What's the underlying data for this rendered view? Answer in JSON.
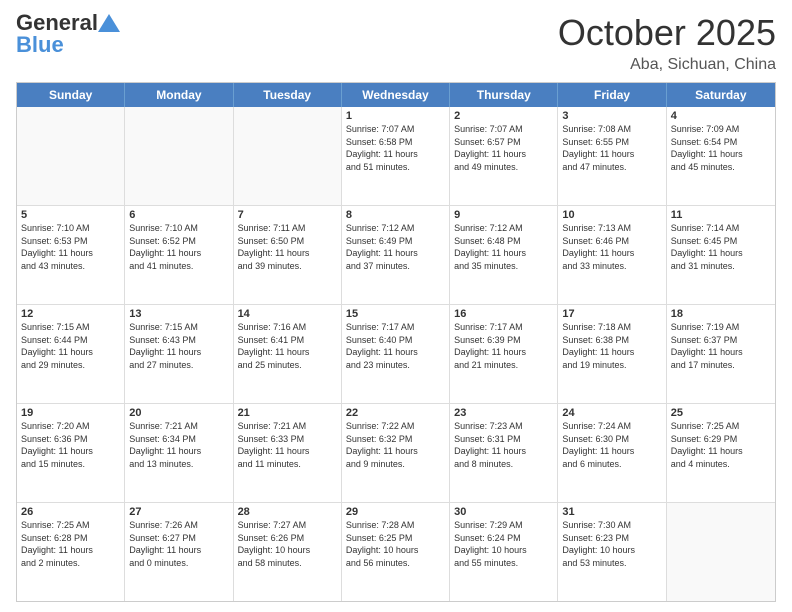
{
  "header": {
    "logo_general": "General",
    "logo_blue": "Blue",
    "title": "October 2025",
    "location": "Aba, Sichuan, China"
  },
  "days_of_week": [
    "Sunday",
    "Monday",
    "Tuesday",
    "Wednesday",
    "Thursday",
    "Friday",
    "Saturday"
  ],
  "weeks": [
    [
      {
        "day": "",
        "info": ""
      },
      {
        "day": "",
        "info": ""
      },
      {
        "day": "",
        "info": ""
      },
      {
        "day": "1",
        "info": "Sunrise: 7:07 AM\nSunset: 6:58 PM\nDaylight: 11 hours\nand 51 minutes."
      },
      {
        "day": "2",
        "info": "Sunrise: 7:07 AM\nSunset: 6:57 PM\nDaylight: 11 hours\nand 49 minutes."
      },
      {
        "day": "3",
        "info": "Sunrise: 7:08 AM\nSunset: 6:55 PM\nDaylight: 11 hours\nand 47 minutes."
      },
      {
        "day": "4",
        "info": "Sunrise: 7:09 AM\nSunset: 6:54 PM\nDaylight: 11 hours\nand 45 minutes."
      }
    ],
    [
      {
        "day": "5",
        "info": "Sunrise: 7:10 AM\nSunset: 6:53 PM\nDaylight: 11 hours\nand 43 minutes."
      },
      {
        "day": "6",
        "info": "Sunrise: 7:10 AM\nSunset: 6:52 PM\nDaylight: 11 hours\nand 41 minutes."
      },
      {
        "day": "7",
        "info": "Sunrise: 7:11 AM\nSunset: 6:50 PM\nDaylight: 11 hours\nand 39 minutes."
      },
      {
        "day": "8",
        "info": "Sunrise: 7:12 AM\nSunset: 6:49 PM\nDaylight: 11 hours\nand 37 minutes."
      },
      {
        "day": "9",
        "info": "Sunrise: 7:12 AM\nSunset: 6:48 PM\nDaylight: 11 hours\nand 35 minutes."
      },
      {
        "day": "10",
        "info": "Sunrise: 7:13 AM\nSunset: 6:46 PM\nDaylight: 11 hours\nand 33 minutes."
      },
      {
        "day": "11",
        "info": "Sunrise: 7:14 AM\nSunset: 6:45 PM\nDaylight: 11 hours\nand 31 minutes."
      }
    ],
    [
      {
        "day": "12",
        "info": "Sunrise: 7:15 AM\nSunset: 6:44 PM\nDaylight: 11 hours\nand 29 minutes."
      },
      {
        "day": "13",
        "info": "Sunrise: 7:15 AM\nSunset: 6:43 PM\nDaylight: 11 hours\nand 27 minutes."
      },
      {
        "day": "14",
        "info": "Sunrise: 7:16 AM\nSunset: 6:41 PM\nDaylight: 11 hours\nand 25 minutes."
      },
      {
        "day": "15",
        "info": "Sunrise: 7:17 AM\nSunset: 6:40 PM\nDaylight: 11 hours\nand 23 minutes."
      },
      {
        "day": "16",
        "info": "Sunrise: 7:17 AM\nSunset: 6:39 PM\nDaylight: 11 hours\nand 21 minutes."
      },
      {
        "day": "17",
        "info": "Sunrise: 7:18 AM\nSunset: 6:38 PM\nDaylight: 11 hours\nand 19 minutes."
      },
      {
        "day": "18",
        "info": "Sunrise: 7:19 AM\nSunset: 6:37 PM\nDaylight: 11 hours\nand 17 minutes."
      }
    ],
    [
      {
        "day": "19",
        "info": "Sunrise: 7:20 AM\nSunset: 6:36 PM\nDaylight: 11 hours\nand 15 minutes."
      },
      {
        "day": "20",
        "info": "Sunrise: 7:21 AM\nSunset: 6:34 PM\nDaylight: 11 hours\nand 13 minutes."
      },
      {
        "day": "21",
        "info": "Sunrise: 7:21 AM\nSunset: 6:33 PM\nDaylight: 11 hours\nand 11 minutes."
      },
      {
        "day": "22",
        "info": "Sunrise: 7:22 AM\nSunset: 6:32 PM\nDaylight: 11 hours\nand 9 minutes."
      },
      {
        "day": "23",
        "info": "Sunrise: 7:23 AM\nSunset: 6:31 PM\nDaylight: 11 hours\nand 8 minutes."
      },
      {
        "day": "24",
        "info": "Sunrise: 7:24 AM\nSunset: 6:30 PM\nDaylight: 11 hours\nand 6 minutes."
      },
      {
        "day": "25",
        "info": "Sunrise: 7:25 AM\nSunset: 6:29 PM\nDaylight: 11 hours\nand 4 minutes."
      }
    ],
    [
      {
        "day": "26",
        "info": "Sunrise: 7:25 AM\nSunset: 6:28 PM\nDaylight: 11 hours\nand 2 minutes."
      },
      {
        "day": "27",
        "info": "Sunrise: 7:26 AM\nSunset: 6:27 PM\nDaylight: 11 hours\nand 0 minutes."
      },
      {
        "day": "28",
        "info": "Sunrise: 7:27 AM\nSunset: 6:26 PM\nDaylight: 10 hours\nand 58 minutes."
      },
      {
        "day": "29",
        "info": "Sunrise: 7:28 AM\nSunset: 6:25 PM\nDaylight: 10 hours\nand 56 minutes."
      },
      {
        "day": "30",
        "info": "Sunrise: 7:29 AM\nSunset: 6:24 PM\nDaylight: 10 hours\nand 55 minutes."
      },
      {
        "day": "31",
        "info": "Sunrise: 7:30 AM\nSunset: 6:23 PM\nDaylight: 10 hours\nand 53 minutes."
      },
      {
        "day": "",
        "info": ""
      }
    ]
  ]
}
